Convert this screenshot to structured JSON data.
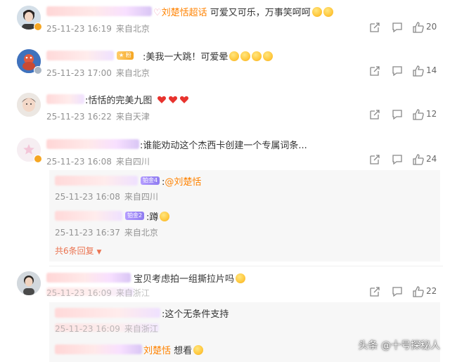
{
  "comments": [
    {
      "text_prefix": "♡",
      "mention": "刘楚恬超话",
      "text": " 可爱又可乐，万事笑呵呵",
      "time": "25-11-23 16:19",
      "location": "来自北京",
      "likes": "20",
      "avatar_icon": "user-avatar-icon"
    },
    {
      "text": ":美我一大跳！可爱晕",
      "time": "25-11-23 17:00",
      "location": "来自北京",
      "likes": "14",
      "avatar_icon": "user-avatar-icon"
    },
    {
      "text": ":恬恬的完美九图",
      "time": "25-11-23 16:22",
      "location": "来自天津",
      "likes": "12",
      "avatar_icon": "user-avatar-icon"
    },
    {
      "text": ":谁能劝动这个杰西卡创建一个专属词条...",
      "time": "25-11-23 16:08",
      "location": "来自四川",
      "likes": "24",
      "avatar_icon": "user-avatar-icon",
      "replies": [
        {
          "tag": "铂金4",
          "text_prefix": ":",
          "mention": "@刘楚恬",
          "text": "",
          "time": "25-11-23 16:08",
          "location": "来自四川"
        },
        {
          "tag": "铂金2",
          "text": ":蹲",
          "time": "25-11-23 16:37",
          "location": "来自北京"
        }
      ],
      "more_replies": "共6条回复"
    },
    {
      "text": "宝贝考虑拍一组撕拉片吗",
      "time": "25-11-23 16:09",
      "location": "来自浙江",
      "likes": "22",
      "avatar_icon": "user-avatar-icon",
      "replies": [
        {
          "text": ":这个无条件支持",
          "time": "25-11-23 16:09",
          "location": "来自浙江"
        },
        {
          "mention": "刘楚恬",
          "text": " 想看",
          "time": "",
          "location": ""
        }
      ]
    }
  ],
  "watermark": "头条 @十号探秘人",
  "colors": {
    "accent": "#ff8200",
    "meta": "#939393",
    "more": "#eb7350"
  }
}
